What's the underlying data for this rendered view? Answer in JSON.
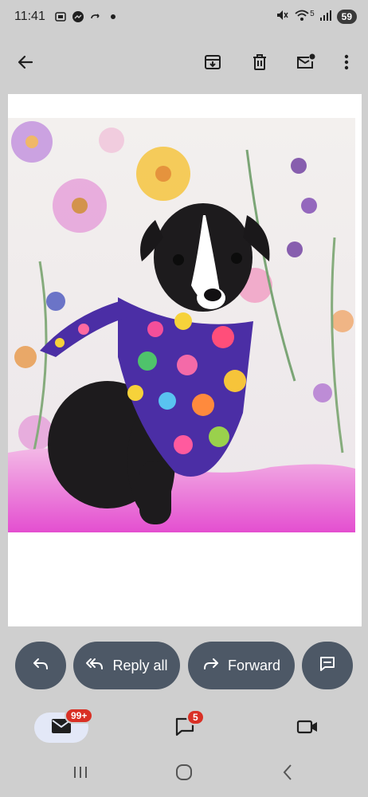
{
  "status_bar": {
    "time": "11:41",
    "network": "5",
    "battery": "59",
    "icons": [
      "screenshot-icon",
      "messenger-icon",
      "call-forward-icon",
      "dot-icon",
      "mute-icon",
      "wifi-icon",
      "signal-icon"
    ]
  },
  "app_bar": {
    "icons": [
      "back-arrow-icon",
      "archive-icon",
      "delete-icon",
      "mark-unread-icon",
      "more-vert-icon"
    ]
  },
  "content": {
    "image": "puppy-photo"
  },
  "actions": {
    "reply_all_label": "Reply all",
    "forward_label": "Forward"
  },
  "bottom_nav": {
    "mail_badge": "99+",
    "chat_badge": "5"
  },
  "colors": {
    "background": "#cfcfcf",
    "pill": "#4d5866",
    "badge": "#d93025",
    "mail_active": "#e3e8f7"
  }
}
